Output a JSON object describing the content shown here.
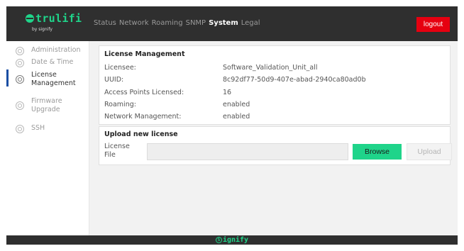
{
  "header": {
    "brand": "trulifi",
    "brand_sub": "by signify",
    "nav": [
      "Status",
      "Network",
      "Roaming",
      "SNMP",
      "System",
      "Legal"
    ],
    "active_nav": "System",
    "logout_label": "logout"
  },
  "sidebar": {
    "items": [
      {
        "label": "Administration",
        "icon": "gear-icon"
      },
      {
        "label": "Date & Time",
        "icon": "clock-icon"
      },
      {
        "label": "License Management",
        "icon": "license-icon"
      },
      {
        "label": "Firmware Upgrade",
        "icon": "firmware-icon"
      },
      {
        "label": "SSH",
        "icon": "ssh-icon"
      }
    ],
    "active_index": 2
  },
  "license": {
    "title": "License Management",
    "rows": [
      {
        "label": "Licensee:",
        "value": "Software_Validation_Unit_all"
      },
      {
        "label": "UUID:",
        "value": "8c92df77-50d9-407e-abad-2940ca80ad0b"
      },
      {
        "label": "Access Points Licensed:",
        "value": "16"
      },
      {
        "label": "Roaming:",
        "value": "enabled"
      },
      {
        "label": "Network Management:",
        "value": "enabled"
      }
    ]
  },
  "upload": {
    "title": "Upload new license",
    "file_label": "License File",
    "file_value": "",
    "browse_label": "Browse",
    "upload_label": "Upload"
  },
  "footer": {
    "brand": "ignify",
    "brand_mark": "S"
  },
  "colors": {
    "accent": "#1fd48a",
    "logout": "#e60010",
    "active_indicator": "#1a4ea3",
    "bar": "#2f2f2f"
  }
}
